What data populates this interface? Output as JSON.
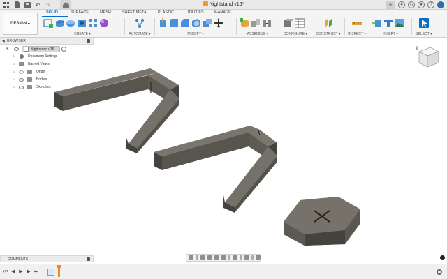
{
  "titlebar": {
    "document_title": "Nightstand v16*"
  },
  "workspace": {
    "label": "DESIGN"
  },
  "tabs": [
    {
      "label": "SOLID",
      "active": true
    },
    {
      "label": "SURFACE",
      "active": false
    },
    {
      "label": "MESH",
      "active": false
    },
    {
      "label": "SHEET METAL",
      "active": false
    },
    {
      "label": "PLASTIC",
      "active": false
    },
    {
      "label": "UTILITIES",
      "active": false
    },
    {
      "label": "MANAGE",
      "active": false
    }
  ],
  "tool_groups": [
    {
      "label": "CREATE ▾"
    },
    {
      "label": "AUTOMATE ▾"
    },
    {
      "label": "MODIFY ▾"
    },
    {
      "label": "ASSEMBLE ▾"
    },
    {
      "label": "CONFIGURE ▾"
    },
    {
      "label": "CONSTRUCT ▾"
    },
    {
      "label": "INSPECT ▾"
    },
    {
      "label": "INSERT ▾"
    },
    {
      "label": "SELECT ▾"
    }
  ],
  "browser": {
    "header": "BROWSER",
    "root": "Nightstand v16",
    "items": [
      {
        "label": "Document Settings"
      },
      {
        "label": "Named Views"
      },
      {
        "label": "Origin"
      },
      {
        "label": "Bodies"
      },
      {
        "label": "Sketches"
      }
    ]
  },
  "comments": {
    "header": "COMMENTS"
  },
  "colors": {
    "accent": "#0a6fc2",
    "body_face_top": "#6f6b63",
    "body_face_side": "#4f4c46",
    "timeline_marker": "#e58b2a",
    "fusion_logo": "#f39a2c"
  },
  "icons": {
    "file": "file-icon",
    "save": "save-icon",
    "undo": "undo-icon",
    "redo": "redo-icon",
    "home": "home-icon",
    "viewcube": "viewcube-icon",
    "settings": "gear-icon"
  }
}
